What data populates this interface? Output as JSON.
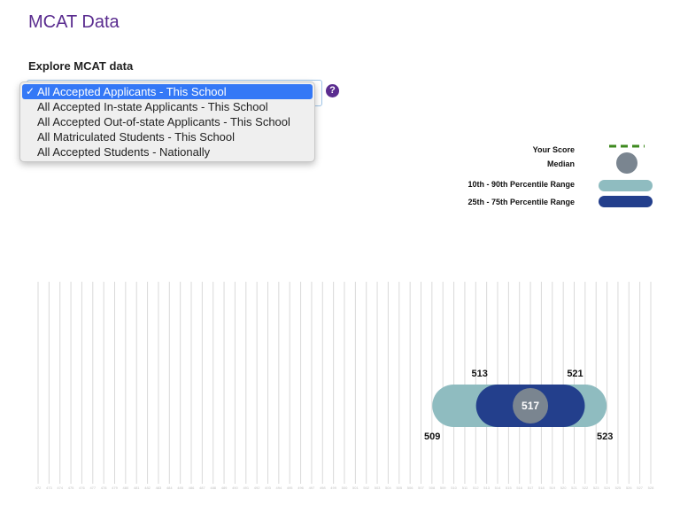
{
  "page": {
    "title": "MCAT Data",
    "explore_label": "Explore MCAT data",
    "help_glyph": "?"
  },
  "dropdown": {
    "options": [
      {
        "label": "All Accepted Applicants - This School",
        "selected": true
      },
      {
        "label": "All Accepted In-state Applicants - This School",
        "selected": false
      },
      {
        "label": "All Accepted Out-of-state Applicants - This School",
        "selected": false
      },
      {
        "label": "All Matriculated Students - This School",
        "selected": false
      },
      {
        "label": "All Accepted Students - Nationally",
        "selected": false
      }
    ],
    "check_glyph": "✓"
  },
  "legend": {
    "your_score": "Your Score",
    "median": "Median",
    "range_10_90": "10th - 90th Percentile Range",
    "range_25_75": "25th - 75th Percentile Range"
  },
  "colors": {
    "title": "#5a2c8f",
    "your_score": "#3e8a1f",
    "median": "#7a8590",
    "range_10_90": "#8fbcc0",
    "range_25_75": "#233f8c",
    "grid": "#d9d9d9"
  },
  "chart_data": {
    "type": "range",
    "x_min": 472,
    "x_max": 528,
    "p10": 509,
    "p25": 513,
    "median": 517,
    "p75": 521,
    "p90": 523,
    "labels": {
      "p10": "509",
      "p25": "513",
      "median": "517",
      "p75": "521",
      "p90": "523"
    }
  }
}
